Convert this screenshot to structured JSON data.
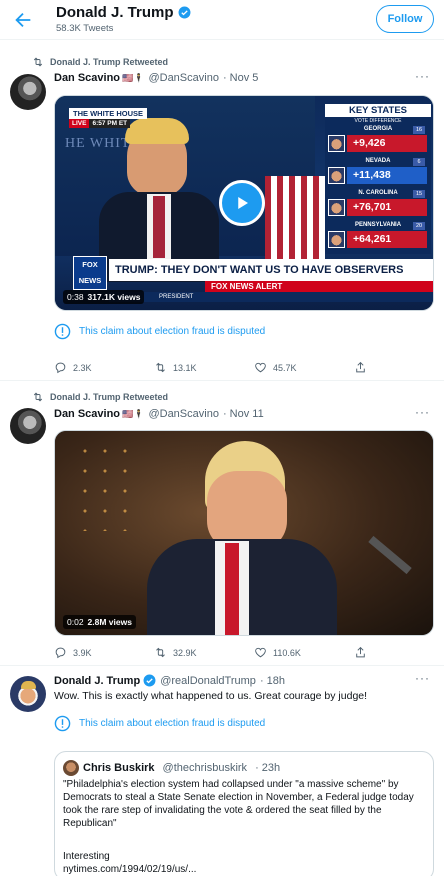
{
  "header": {
    "title": "Donald J. Trump",
    "tweet_count": "58.3K Tweets",
    "follow_label": "Follow"
  },
  "tweets": [
    {
      "retweet_label": "Donald J. Trump Retweeted",
      "author": "Dan Scavino",
      "author_emoji": "🇺🇸🕴",
      "handle": "@DanScavino",
      "date": "· Nov 5",
      "media": {
        "timestamp": "0:38",
        "views": "317.1K views",
        "overlay": {
          "wh_label": "THE WHITE HOUSE",
          "live": "LIVE",
          "live_time": "6:57 PM ET",
          "key_states": "KEY STATES",
          "vote_diff": "VOTE DIFFERENCE",
          "states": [
            {
              "name": "GEORGIA",
              "ev": "16",
              "diff": "+9,426",
              "party": "r"
            },
            {
              "name": "NEVADA",
              "ev": "6",
              "diff": "+11,438",
              "party": "d"
            },
            {
              "name": "N. CAROLINA",
              "ev": "15",
              "diff": "+76,701",
              "party": "r"
            },
            {
              "name": "PENNSYLVANIA",
              "ev": "20",
              "diff": "+64,261",
              "party": "r"
            }
          ],
          "fox_logo": "FOX NEWS",
          "headline": "TRUMP: THEY DON'T WANT US TO HAVE OBSERVERS",
          "alert": "FOX NEWS ALERT",
          "president": "PRESIDENT"
        }
      },
      "claim": "This claim about election fraud is disputed",
      "replies": "2.3K",
      "retweets": "13.1K",
      "likes": "45.7K"
    },
    {
      "retweet_label": "Donald J. Trump Retweeted",
      "author": "Dan Scavino",
      "author_emoji": "🇺🇸🕴",
      "handle": "@DanScavino",
      "date": "· Nov 11",
      "media": {
        "timestamp": "0:02",
        "views": "2.8M views"
      },
      "replies": "3.9K",
      "retweets": "32.9K",
      "likes": "110.6K"
    },
    {
      "author": "Donald J. Trump",
      "handle": "@realDonaldTrump",
      "date": "· 18h",
      "text": "Wow. This is exactly what happened to us. Great courage by judge!",
      "claim": "This claim about election fraud is disputed",
      "quote": {
        "author": "Chris Buskirk",
        "handle": "@thechrisbuskirk",
        "date": "· 23h",
        "text": "\"Philadelphia's election system had collapsed under \"a massive scheme\" by Democrats to steal a State Senate election in November, a Federal judge today took the rare step of invalidating the vote & ordered the seat filled by the Republican\"",
        "text2": "Interesting",
        "link": "nytimes.com/1994/02/19/us/..."
      }
    }
  ],
  "colors": {
    "accent": "#1d9bf0",
    "muted": "#536471",
    "border": "#eff3f4"
  }
}
